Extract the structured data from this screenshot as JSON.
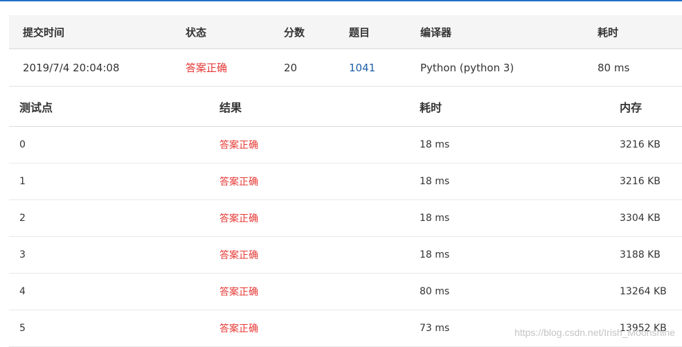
{
  "summary": {
    "headers": {
      "time": "提交时间",
      "status": "状态",
      "score": "分数",
      "problem": "题目",
      "compiler": "编译器",
      "duration": "耗时"
    },
    "row": {
      "time": "2019/7/4 20:04:08",
      "status": "答案正确",
      "score": "20",
      "problem": "1041",
      "compiler": "Python (python 3)",
      "duration": "80 ms"
    }
  },
  "testcases": {
    "headers": {
      "case": "测试点",
      "result": "结果",
      "duration": "耗时",
      "memory": "内存"
    },
    "rows": [
      {
        "case": "0",
        "result": "答案正确",
        "duration": "18 ms",
        "memory": "3216 KB"
      },
      {
        "case": "1",
        "result": "答案正确",
        "duration": "18 ms",
        "memory": "3216 KB"
      },
      {
        "case": "2",
        "result": "答案正确",
        "duration": "18 ms",
        "memory": "3304 KB"
      },
      {
        "case": "3",
        "result": "答案正确",
        "duration": "18 ms",
        "memory": "3188 KB"
      },
      {
        "case": "4",
        "result": "答案正确",
        "duration": "80 ms",
        "memory": "13264 KB"
      },
      {
        "case": "5",
        "result": "答案正确",
        "duration": "73 ms",
        "memory": "13952 KB"
      }
    ]
  },
  "watermark": "https://blog.csdn.net/Irish_Moonshine",
  "colors": {
    "accent_line": "#1f6fc5",
    "success_text": "#e53935",
    "link": "#1a5ea8"
  }
}
